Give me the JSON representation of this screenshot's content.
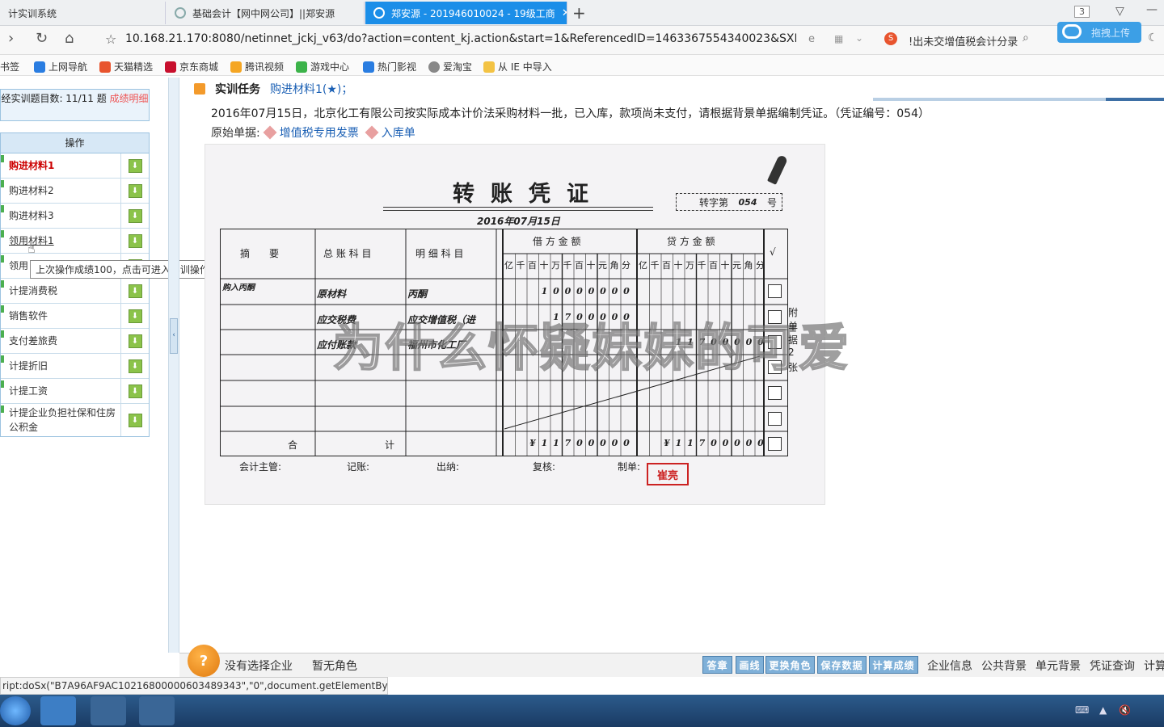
{
  "browser": {
    "tabs": [
      {
        "title": "计实训系统",
        "active": false
      },
      {
        "title": "基础会计【网中网公司】||郑安源",
        "active": false
      },
      {
        "title": "郑安源 - 201946010024 - 19级工商",
        "active": true
      }
    ],
    "tab_count": "3",
    "url": "10.168.21.170:8080/netinnet_jckj_v63/do?action=content_kj.action&start=1&ReferencedID=1463367554340023&SXID=004",
    "search_text": "!出未交增值税会计分录",
    "upload_label": "拖拽上传",
    "bookmarks": [
      "书签",
      "上网导航",
      "天猫精选",
      "京东商城",
      "腾讯视频",
      "游戏中心",
      "热门影视",
      "爱淘宝",
      "从 IE 中导入"
    ]
  },
  "sidebar": {
    "progress_text": "经实训题目数: 11/11 题",
    "grade_link": "成绩明细",
    "ops_header": "操作",
    "items": [
      {
        "label": "购进材料1",
        "current": true
      },
      {
        "label": "购进材料2"
      },
      {
        "label": "购进材料3"
      },
      {
        "label": "领用材料1"
      },
      {
        "label": "领用"
      },
      {
        "label": "计提消费税"
      },
      {
        "label": "销售软件"
      },
      {
        "label": "支付差旅费"
      },
      {
        "label": "计提折旧"
      },
      {
        "label": "计提工资"
      },
      {
        "label": "计提企业负担社保和住房公积金"
      }
    ],
    "tooltip": "上次操作成绩100，点击可进入实训操作。"
  },
  "task": {
    "label": "实训任务",
    "name": "购进材料1(★)；",
    "description": "2016年07月15日，北京化工有限公司按实际成本计价法采购材料一批，已入库，款项尚未支付，请根据背景单据编制凭证。（凭证编号：054）",
    "source_label": "原始单据:",
    "sources": [
      "增值税专用发票",
      "入库单"
    ]
  },
  "voucher": {
    "title": "转账凭证",
    "number_prefix": "转字第",
    "number": "054",
    "number_suffix": "号",
    "date": "2016年07月15日",
    "headers": {
      "summary": "摘　　要",
      "account": "总 账 科 目",
      "detail": "明 细 科 目",
      "debit": "借 方 金 额",
      "credit": "贷 方 金 额",
      "check": "√"
    },
    "units": [
      "亿",
      "千",
      "百",
      "十",
      "万",
      "千",
      "百",
      "十",
      "元",
      "角",
      "分"
    ],
    "rows": [
      {
        "summary": "购入丙酮",
        "account": "原材料",
        "detail": "丙酮",
        "debit": "10000000",
        "credit": ""
      },
      {
        "summary": "",
        "account": "应交税费",
        "detail": "应交增值税（进",
        "debit": "1700000",
        "credit": ""
      },
      {
        "summary": "",
        "account": "应付账款",
        "detail": "福州市化工厂",
        "debit": "",
        "credit": "11700000"
      }
    ],
    "total_label": "合　　　　　　　　　计",
    "total_debit": "¥11700000",
    "total_credit": "¥11700000",
    "attach": [
      "附",
      "单",
      "据",
      "2",
      "张"
    ],
    "signers": [
      "会计主管:",
      "记账:",
      "出纳:",
      "复核:",
      "制单:"
    ],
    "maker_stamp": "崔亮"
  },
  "watermark": "为什么怀疑妹妹的可爱",
  "bottom": {
    "no_company": "没有选择企业",
    "no_role": "暂无角色",
    "tools": [
      "答章",
      "画线",
      "更换角色",
      "保存数据",
      "计算成绩"
    ],
    "links": [
      "企业信息",
      "公共背景",
      "单元背景",
      "凭证查询",
      "计算"
    ]
  },
  "status": "ript:doSx(\"B7A96AF9AC10216800000603489343\",\"0\",document.getElementById(\"..."
}
